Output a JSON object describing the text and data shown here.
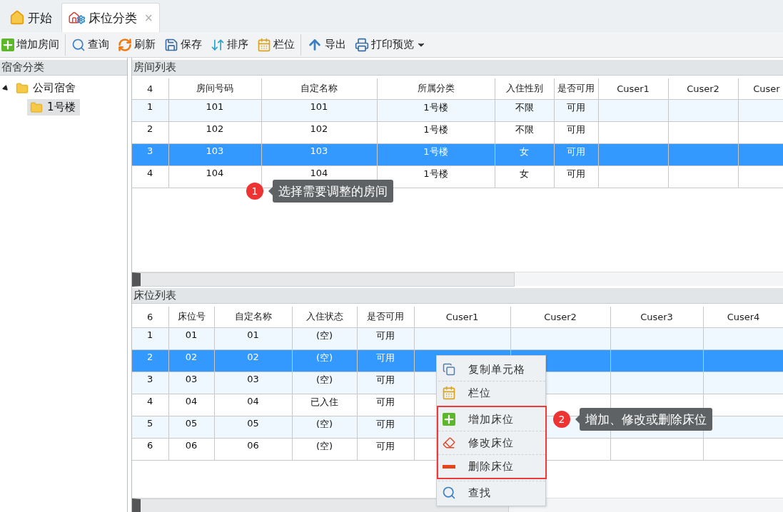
{
  "tabs": [
    {
      "label": "开始",
      "kind": "home",
      "selected": false
    },
    {
      "label": "床位分类",
      "kind": "home-gear",
      "selected": true,
      "close": "×"
    }
  ],
  "toolbar": {
    "groups": [
      [
        {
          "label": "增加房间",
          "kind": "add"
        }
      ],
      [
        {
          "label": "查询",
          "kind": "search"
        },
        {
          "label": "刷新",
          "kind": "refresh"
        },
        {
          "label": "保存",
          "kind": "save"
        },
        {
          "label": "排序",
          "kind": "sort"
        },
        {
          "label": "栏位",
          "kind": "columns"
        }
      ],
      [
        {
          "label": "导出",
          "kind": "export"
        },
        {
          "label": "打印预览",
          "kind": "print",
          "dropdown": true
        }
      ]
    ]
  },
  "sidebar": {
    "title": "宿舍分类",
    "tree": [
      {
        "label": "公司宿舍",
        "expanded": true,
        "selected": false,
        "children": [
          {
            "label": "1号楼",
            "selected": true
          }
        ]
      }
    ]
  },
  "rooms": {
    "title": "房间列表",
    "columns": [
      "4",
      "房间号码",
      "自定名称",
      "所属分类",
      "入住性别",
      "是否可用",
      "Cuser1",
      "Cuser2",
      "Cuser"
    ],
    "rows": [
      {
        "cells": [
          "1",
          "101",
          "101",
          "1号楼",
          "不限",
          "可用",
          "",
          "",
          ""
        ],
        "selected": false
      },
      {
        "cells": [
          "2",
          "102",
          "102",
          "1号楼",
          "不限",
          "可用",
          "",
          "",
          ""
        ],
        "selected": false
      },
      {
        "cells": [
          "3",
          "103",
          "103",
          "1号楼",
          "女",
          "可用",
          "",
          "",
          ""
        ],
        "selected": true
      },
      {
        "cells": [
          "4",
          "104",
          "104",
          "1号楼",
          "女",
          "可用",
          "",
          "",
          ""
        ],
        "selected": false
      }
    ]
  },
  "beds": {
    "title": "床位列表",
    "columns": [
      "6",
      "床位号",
      "自定名称",
      "入住状态",
      "是否可用",
      "Cuser1",
      "Cuser2",
      "Cuser3",
      "Cuser4"
    ],
    "rows": [
      {
        "cells": [
          "1",
          "01",
          "01",
          "(空)",
          "可用",
          "",
          "",
          "",
          ""
        ],
        "selected": false
      },
      {
        "cells": [
          "2",
          "02",
          "02",
          "(空)",
          "可用",
          "",
          "",
          "",
          ""
        ],
        "selected": true
      },
      {
        "cells": [
          "3",
          "03",
          "03",
          "(空)",
          "可用",
          "",
          "",
          "",
          ""
        ],
        "selected": false
      },
      {
        "cells": [
          "4",
          "04",
          "04",
          "已入住",
          "可用",
          "",
          "",
          "",
          ""
        ],
        "selected": false
      },
      {
        "cells": [
          "5",
          "05",
          "05",
          "(空)",
          "可用",
          "",
          "",
          "",
          ""
        ],
        "selected": false
      },
      {
        "cells": [
          "6",
          "06",
          "06",
          "(空)",
          "可用",
          "",
          "",
          "",
          ""
        ],
        "selected": false
      }
    ]
  },
  "context_menu": {
    "sections": [
      {
        "highlighted": false,
        "items": [
          {
            "label": "复制单元格",
            "kind": "copy"
          },
          {
            "label": "栏位",
            "kind": "columns"
          }
        ]
      },
      {
        "highlighted": true,
        "items": [
          {
            "label": "增加床位",
            "kind": "add"
          },
          {
            "label": "修改床位",
            "kind": "edit"
          },
          {
            "label": "删除床位",
            "kind": "delete"
          }
        ]
      },
      {
        "highlighted": false,
        "items": [
          {
            "label": "查找",
            "kind": "search"
          }
        ]
      }
    ]
  },
  "callouts": [
    {
      "number": "1",
      "text": "选择需要调整的房间"
    },
    {
      "number": "2",
      "text": "增加、修改或删除床位"
    }
  ]
}
